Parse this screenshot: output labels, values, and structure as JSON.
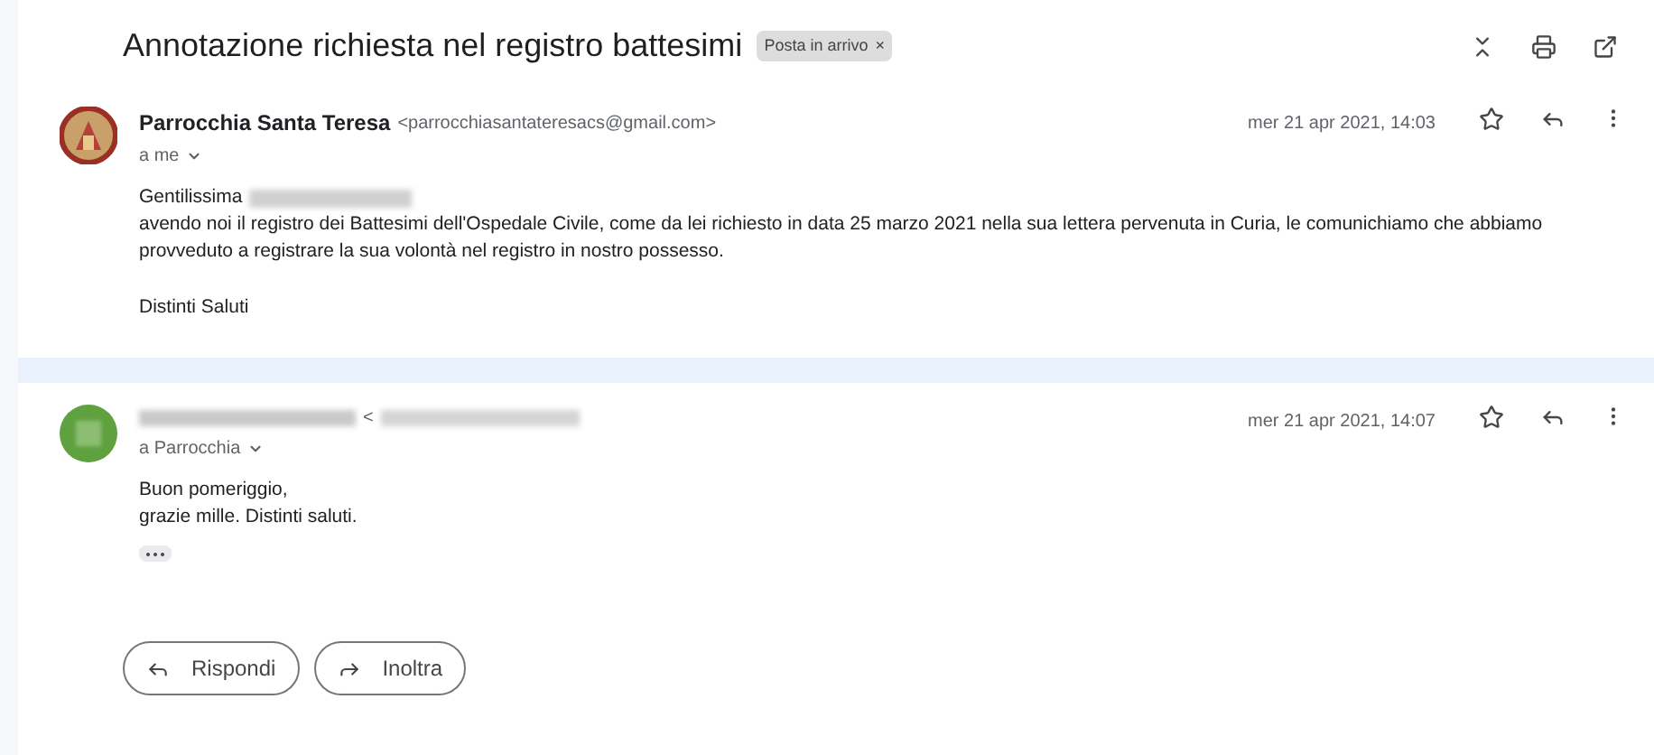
{
  "subject": "Annotazione richiesta nel registro battesimi",
  "label": {
    "text": "Posta in arrivo",
    "remove": "×"
  },
  "messages": [
    {
      "kind": "logo",
      "sender": "Parrocchia Santa Teresa",
      "sender_redacted": false,
      "email": "<parrocchiasantateresacs@gmail.com>",
      "recipient": "a me",
      "date": "mer 21 apr 2021, 14:03",
      "starred": false,
      "body": [
        {
          "kind": "greeting",
          "text": "Gentilissima",
          "redacted": true
        },
        {
          "kind": "text",
          "text": "avendo noi il registro dei Battesimi dell'Ospedale Civile, come da lei richiesto in data 25 marzo 2021 nella sua lettera pervenuta in Curia, le comunichiamo che abbiamo provveduto a registrare la sua volontà nel registro in nostro possesso."
        },
        {
          "kind": "gap"
        },
        {
          "kind": "text",
          "text": "Distinti Saluti"
        }
      ],
      "trimmed": false
    },
    {
      "kind": "blurred",
      "sender_redacted": true,
      "email": "<",
      "recipient": "a Parrocchia",
      "date": "mer 21 apr 2021, 14:07",
      "starred": false,
      "body": [
        {
          "kind": "text",
          "text": "Buon pomeriggio,"
        },
        {
          "kind": "text",
          "text": "grazie mille. Distinti saluti."
        }
      ],
      "trimmed": true
    }
  ],
  "actions": [
    {
      "kind": "reply",
      "label": "Rispondi"
    },
    {
      "kind": "forward",
      "label": "Inoltra"
    }
  ]
}
